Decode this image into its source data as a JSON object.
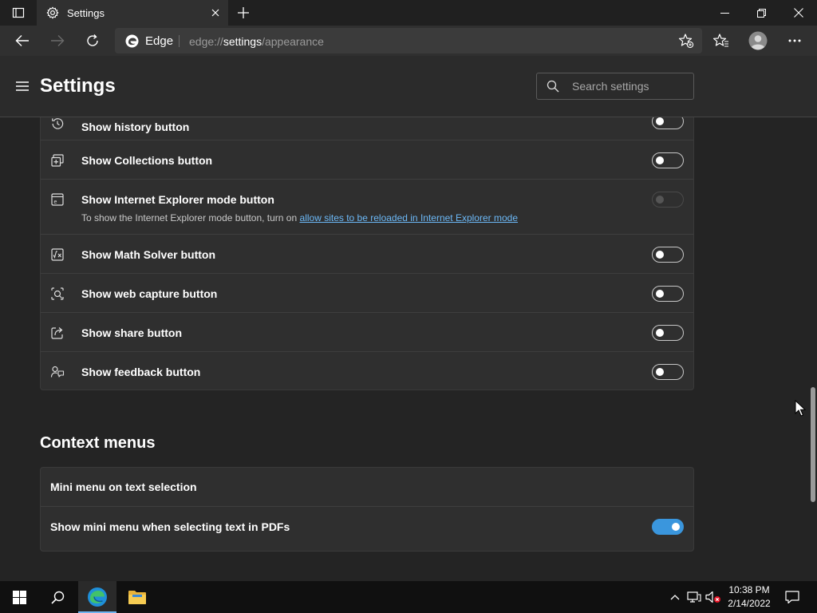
{
  "browser": {
    "tab_title": "Settings",
    "address_site_label": "Edge",
    "address_scheme": "edge://",
    "address_host": "settings",
    "address_path": "/appearance"
  },
  "header": {
    "title": "Settings",
    "search_placeholder": "Search settings"
  },
  "toolbar_rows": [
    {
      "label": "Show history button",
      "icon": "history-icon",
      "toggle": "off"
    },
    {
      "label": "Show Collections button",
      "icon": "collections-icon",
      "toggle": "off"
    },
    {
      "label": "Show Internet Explorer mode button",
      "icon": "ie-mode-icon",
      "toggle": "disabled",
      "sub_text": "To show the Internet Explorer mode button, turn on",
      "sub_link": "allow sites to be reloaded in Internet Explorer mode"
    },
    {
      "label": "Show Math Solver button",
      "icon": "math-solver-icon",
      "toggle": "off"
    },
    {
      "label": "Show web capture button",
      "icon": "web-capture-icon",
      "toggle": "off"
    },
    {
      "label": "Show share button",
      "icon": "share-icon",
      "toggle": "off"
    },
    {
      "label": "Show feedback button",
      "icon": "feedback-icon",
      "toggle": "off"
    }
  ],
  "context_menus": {
    "title": "Context menus",
    "rows": [
      {
        "label": "Mini menu on text selection"
      },
      {
        "label": "Show mini menu when selecting text in PDFs",
        "toggle": "on"
      }
    ]
  },
  "taskbar": {
    "time": "10:38 PM",
    "date": "2/14/2022"
  },
  "colors": {
    "accent": "#3a96dd",
    "link": "#6cb8f6",
    "background": "#242424",
    "card": "#2f2f2f"
  }
}
